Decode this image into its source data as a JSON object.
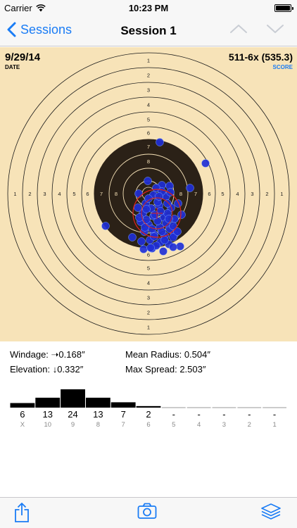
{
  "status_bar": {
    "carrier": "Carrier",
    "time": "10:23 PM",
    "wifi_icon": "wifi-icon",
    "battery_icon": "battery-icon"
  },
  "nav": {
    "back_label": "Sessions",
    "title": "Session 1",
    "back_icon": "chevron-left-icon",
    "prev_icon": "chevron-up-icon",
    "next_icon": "chevron-down-icon"
  },
  "target": {
    "date": "9/29/14",
    "date_label": "DATE",
    "score": "511-6x (535.3)",
    "score_label": "SCORE",
    "ring_labels": [
      "1",
      "2",
      "3",
      "4",
      "5",
      "6",
      "7",
      "8"
    ],
    "center_label": "X",
    "colors": {
      "paper": "#f7e3b8",
      "bull": "#2b2117",
      "shot": "#1f2fd6",
      "group_circle": "#e0241b",
      "accent": "#1a7cf5"
    }
  },
  "stats": {
    "windage": "Windage: ➝0.168″",
    "elevation": "Elevation: ↓0.332″",
    "mean_radius": "Mean Radius: 0.504″",
    "max_spread": "Max Spread: 2.503″"
  },
  "histogram": {
    "bins": [
      {
        "label": "X",
        "count": 6,
        "display": "6"
      },
      {
        "label": "10",
        "count": 13,
        "display": "13"
      },
      {
        "label": "9",
        "count": 24,
        "display": "24"
      },
      {
        "label": "8",
        "count": 13,
        "display": "13"
      },
      {
        "label": "7",
        "count": 7,
        "display": "7"
      },
      {
        "label": "6",
        "count": 2,
        "display": "2"
      },
      {
        "label": "5",
        "count": 0,
        "display": "-"
      },
      {
        "label": "4",
        "count": 0,
        "display": "-"
      },
      {
        "label": "3",
        "count": 0,
        "display": "-"
      },
      {
        "label": "2",
        "count": 0,
        "display": "-"
      },
      {
        "label": "1",
        "count": 0,
        "display": "-"
      }
    ]
  },
  "toolbar": {
    "share_icon": "share-icon",
    "camera_icon": "camera-icon",
    "stack_icon": "layers-icon"
  }
}
